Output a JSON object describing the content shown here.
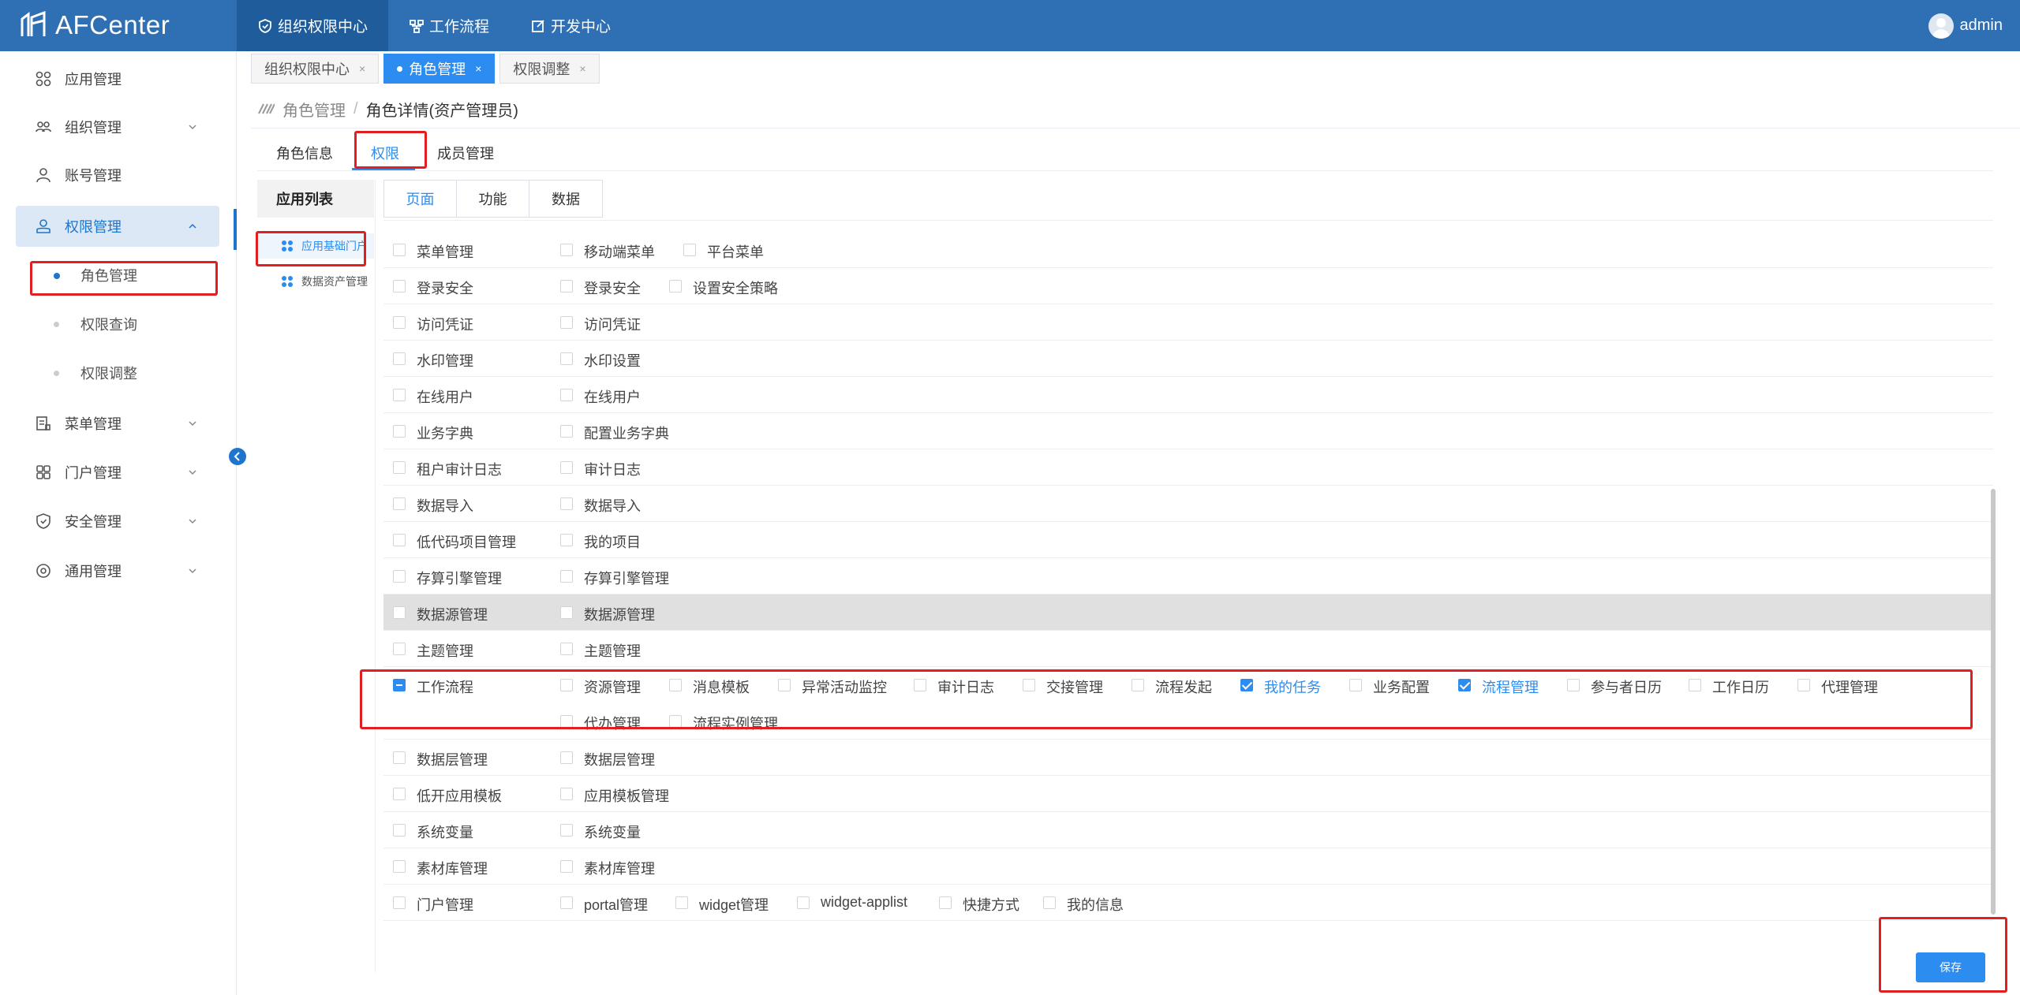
{
  "app": {
    "name": "AFCenter"
  },
  "topnav": [
    {
      "label": "组织权限中心",
      "icon": "shield-icon",
      "active": true
    },
    {
      "label": "工作流程",
      "icon": "workflow-icon",
      "active": false
    },
    {
      "label": "开发中心",
      "icon": "edit-icon",
      "active": false
    }
  ],
  "user": {
    "name": "admin"
  },
  "sidebar": {
    "items": [
      {
        "label": "应用管理",
        "icon": "apps-icon"
      },
      {
        "label": "组织管理",
        "icon": "org-icon"
      },
      {
        "label": "账号管理",
        "icon": "user-icon"
      },
      {
        "label": "权限管理",
        "icon": "permission-icon"
      },
      {
        "label": "菜单管理",
        "icon": "menu-icon"
      },
      {
        "label": "门户管理",
        "icon": "portal-icon"
      },
      {
        "label": "安全管理",
        "icon": "security-icon"
      },
      {
        "label": "通用管理",
        "icon": "settings-icon"
      }
    ],
    "sub_items": [
      "角色管理",
      "权限查询",
      "权限调整"
    ]
  },
  "tabs": [
    {
      "label": "组织权限中心",
      "close": "×"
    },
    {
      "label": "角色管理",
      "close": "×"
    },
    {
      "label": "权限调整",
      "close": "×"
    }
  ],
  "breadcrumb": {
    "parent": "角色管理",
    "sep": "/",
    "current": "角色详情(资产管理员)"
  },
  "detail_tabs": [
    "角色信息",
    "权限",
    "成员管理"
  ],
  "applist": {
    "title": "应用列表",
    "items": [
      "应用基础门户",
      "数据资产管理"
    ]
  },
  "perm_tabs": [
    "页面",
    "功能",
    "数据"
  ],
  "rows": [
    {
      "name": "菜单管理",
      "children": [
        "移动端菜单",
        "平台菜单"
      ]
    },
    {
      "name": "登录安全",
      "children": [
        "登录安全",
        "设置安全策略"
      ]
    },
    {
      "name": "访问凭证",
      "children": [
        "访问凭证"
      ]
    },
    {
      "name": "水印管理",
      "children": [
        "水印设置"
      ]
    },
    {
      "name": "在线用户",
      "children": [
        "在线用户"
      ]
    },
    {
      "name": "业务字典",
      "children": [
        "配置业务字典"
      ]
    },
    {
      "name": "租户审计日志",
      "children": [
        "审计日志"
      ]
    },
    {
      "name": "数据导入",
      "children": [
        "数据导入"
      ]
    },
    {
      "name": "低代码项目管理",
      "children": [
        "我的项目"
      ]
    },
    {
      "name": "存算引擎管理",
      "children": [
        "存算引擎管理"
      ]
    },
    {
      "name": "数据源管理",
      "children": [
        "数据源管理"
      ]
    },
    {
      "name": "主题管理",
      "children": [
        "主题管理"
      ]
    },
    {
      "name": "工作流程",
      "children": [
        "资源管理",
        "消息模板",
        "异常活动监控",
        "审计日志",
        "交接管理",
        "流程发起",
        "我的任务",
        "业务配置",
        "流程管理",
        "参与者日历",
        "工作日历",
        "代理管理",
        "代办管理",
        "流程实例管理"
      ]
    },
    {
      "name": "数据层管理",
      "children": [
        "数据层管理"
      ]
    },
    {
      "name": "低开应用模板",
      "children": [
        "应用模板管理"
      ]
    },
    {
      "name": "系统变量",
      "children": [
        "系统变量"
      ]
    },
    {
      "name": "素材库管理",
      "children": [
        "素材库管理"
      ]
    },
    {
      "name": "门户管理",
      "children": [
        "portal管理",
        "widget管理",
        "widget-applist",
        "快捷方式",
        "我的信息"
      ]
    }
  ],
  "save_label": "保存"
}
